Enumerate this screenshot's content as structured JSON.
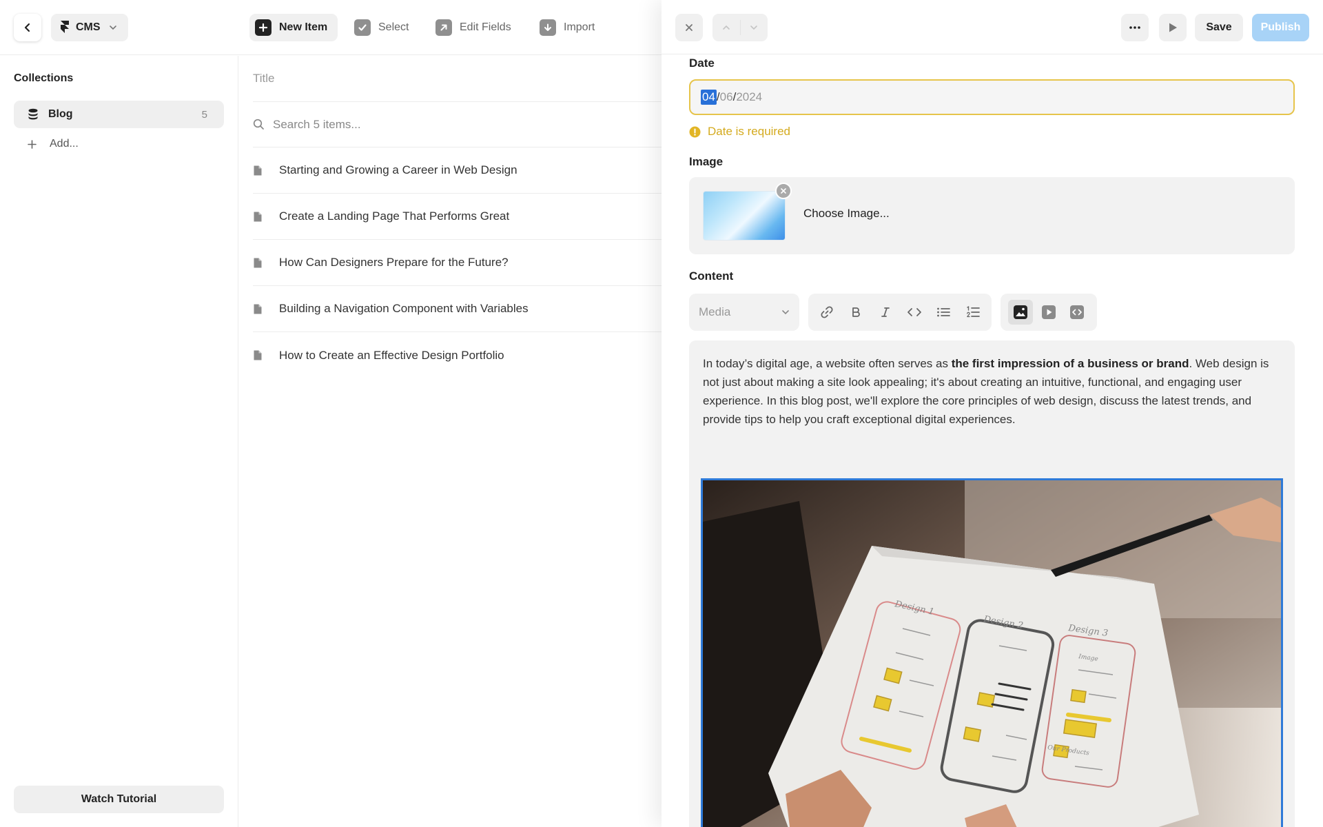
{
  "topbar": {
    "app_label": "CMS",
    "tools": {
      "new_item": "New Item",
      "select": "Select",
      "edit_fields": "Edit Fields",
      "import": "Import"
    }
  },
  "sidebar": {
    "title": "Collections",
    "collections": [
      {
        "label": "Blog",
        "count": "5"
      }
    ],
    "add_label": "Add...",
    "watch_tutorial": "Watch Tutorial"
  },
  "list": {
    "column_header": "Title",
    "search_placeholder": "Search 5 items...",
    "items": [
      "Starting and Growing a Career in Web Design",
      "Create a Landing Page That Performs Great",
      "How Can Designers Prepare for the Future?",
      "Building a Navigation Component with Variables",
      "How to Create an Effective Design Portfolio"
    ]
  },
  "editor": {
    "save_label": "Save",
    "publish_label": "Publish",
    "date": {
      "label": "Date",
      "day": "04",
      "month": "06",
      "year": "2024",
      "separator": "/",
      "error": "Date is required"
    },
    "image": {
      "label": "Image",
      "choose_label": "Choose Image..."
    },
    "content": {
      "label": "Content",
      "block_type": "Media",
      "text_before": "In today’s digital age, a website often serves as ",
      "text_bold": "the first impression of a business or brand",
      "text_after": ". Web design is not just about making a site look appealing; it's about creating an intuitive, functional, and engaging user experience. In this blog post, we'll explore the core principles of web design, discuss the latest trends, and provide tips to help you craft exceptional digital experiences.",
      "image_sketch_labels": [
        "Design 1",
        "Design 2",
        "Design 3",
        "Image",
        "Our Products"
      ]
    }
  },
  "colors": {
    "accent_blue": "#2e7ad8",
    "publish_bg": "#a8d3f7",
    "warning": "#d4aa1e",
    "sketch_yellow": "#e8c830"
  }
}
